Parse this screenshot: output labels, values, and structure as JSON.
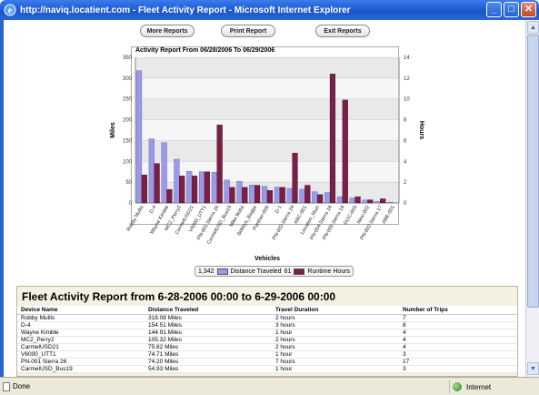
{
  "window": {
    "title": "http://naviq.locatient.com - Fleet Activity Report - Microsoft Internet Explorer",
    "minimize": "_",
    "maximize": "□",
    "close": "✕"
  },
  "toolbar": {
    "more_reports": "More Reports",
    "print_report": "Print Report",
    "exit_reports": "Exit Reports"
  },
  "chart_data": {
    "type": "bar",
    "title": "Activity Report From 06/28/2006 To 06/29/2006",
    "xlabel": "Vehicles",
    "ylabel": "Miles",
    "y2label": "Hours",
    "ylim": [
      0,
      350
    ],
    "y2lim": [
      0,
      14
    ],
    "yticks": [
      0,
      50,
      100,
      150,
      200,
      250,
      300,
      350
    ],
    "y2ticks": [
      0,
      2,
      4,
      6,
      8,
      10,
      12,
      14
    ],
    "categories": [
      "Robby Mullis",
      "D-4",
      "Wayne Kimble",
      "MC2_Perry2",
      "CarmelUSD21",
      "V6000_UTT1",
      "PN-001 Sierra 26",
      "CarmelUSD_Bus19",
      "Mike Botta",
      "Bobbys_Baggs",
      "Panther-006",
      "D-1",
      "PN-003 Sierra 24",
      "ABC-001",
      "Location_Mazi",
      "PN-004 Sierra 18",
      "PN-005 Sierra 19",
      "DOC-003",
      "New-002",
      "PN-002 Sierra 17",
      "ABE-001"
    ],
    "series": [
      {
        "name": "Distance Traveled",
        "axis": "left",
        "color": "#9a9ae6",
        "values": [
          318,
          154,
          145,
          105,
          76,
          75,
          74,
          55,
          52,
          43,
          40,
          38,
          35,
          33,
          27,
          25,
          15,
          12,
          7,
          4,
          2
        ]
      },
      {
        "name": "Runtime Hours",
        "axis": "right",
        "color": "#7a1f45",
        "values": [
          2.7,
          3.8,
          1.3,
          2.6,
          2.6,
          3.0,
          7.5,
          1.5,
          1.5,
          1.7,
          1.2,
          1.5,
          4.8,
          1.7,
          0.8,
          12.4,
          9.9,
          0.6,
          0.3,
          0.4,
          0.0
        ]
      }
    ],
    "grid": true,
    "legend_position": "bottom"
  },
  "legend": {
    "distance_total": "1,342",
    "distance_label": "Distance Traveled",
    "hours_total": "61",
    "hours_label": "Runtime Hours"
  },
  "report": {
    "heading": "Fleet Activity Report from 6-28-2006 00:00 to 6-29-2006 00:00",
    "columns": [
      "Device Name",
      "Distance Traveled",
      "Travel Duration",
      "Number of Trips"
    ],
    "rows": [
      [
        "Robby Mullis",
        "318.08 Miles",
        "2 hours",
        "7"
      ],
      [
        "D-4",
        "154.51 Miles",
        "3 hours",
        "8"
      ],
      [
        "Wayne Kimble",
        "144.91 Miles",
        "1 hour",
        "4"
      ],
      [
        "MC2_Perry2",
        "105.32 Miles",
        "2 hours",
        "4"
      ],
      [
        "CarmelUSD21",
        "75.82 Miles",
        "2 hours",
        "4"
      ],
      [
        "V6000_UTT1",
        "74.71 Miles",
        "1 hour",
        "3"
      ],
      [
        "PN-001 Sierra 26",
        "74.20 Miles",
        "7 hours",
        "17"
      ],
      [
        "CarmelUSD_Bus19",
        "54.93 Miles",
        "1 hour",
        "3"
      ]
    ]
  },
  "status": {
    "done": "Done",
    "zone": "Internet"
  }
}
